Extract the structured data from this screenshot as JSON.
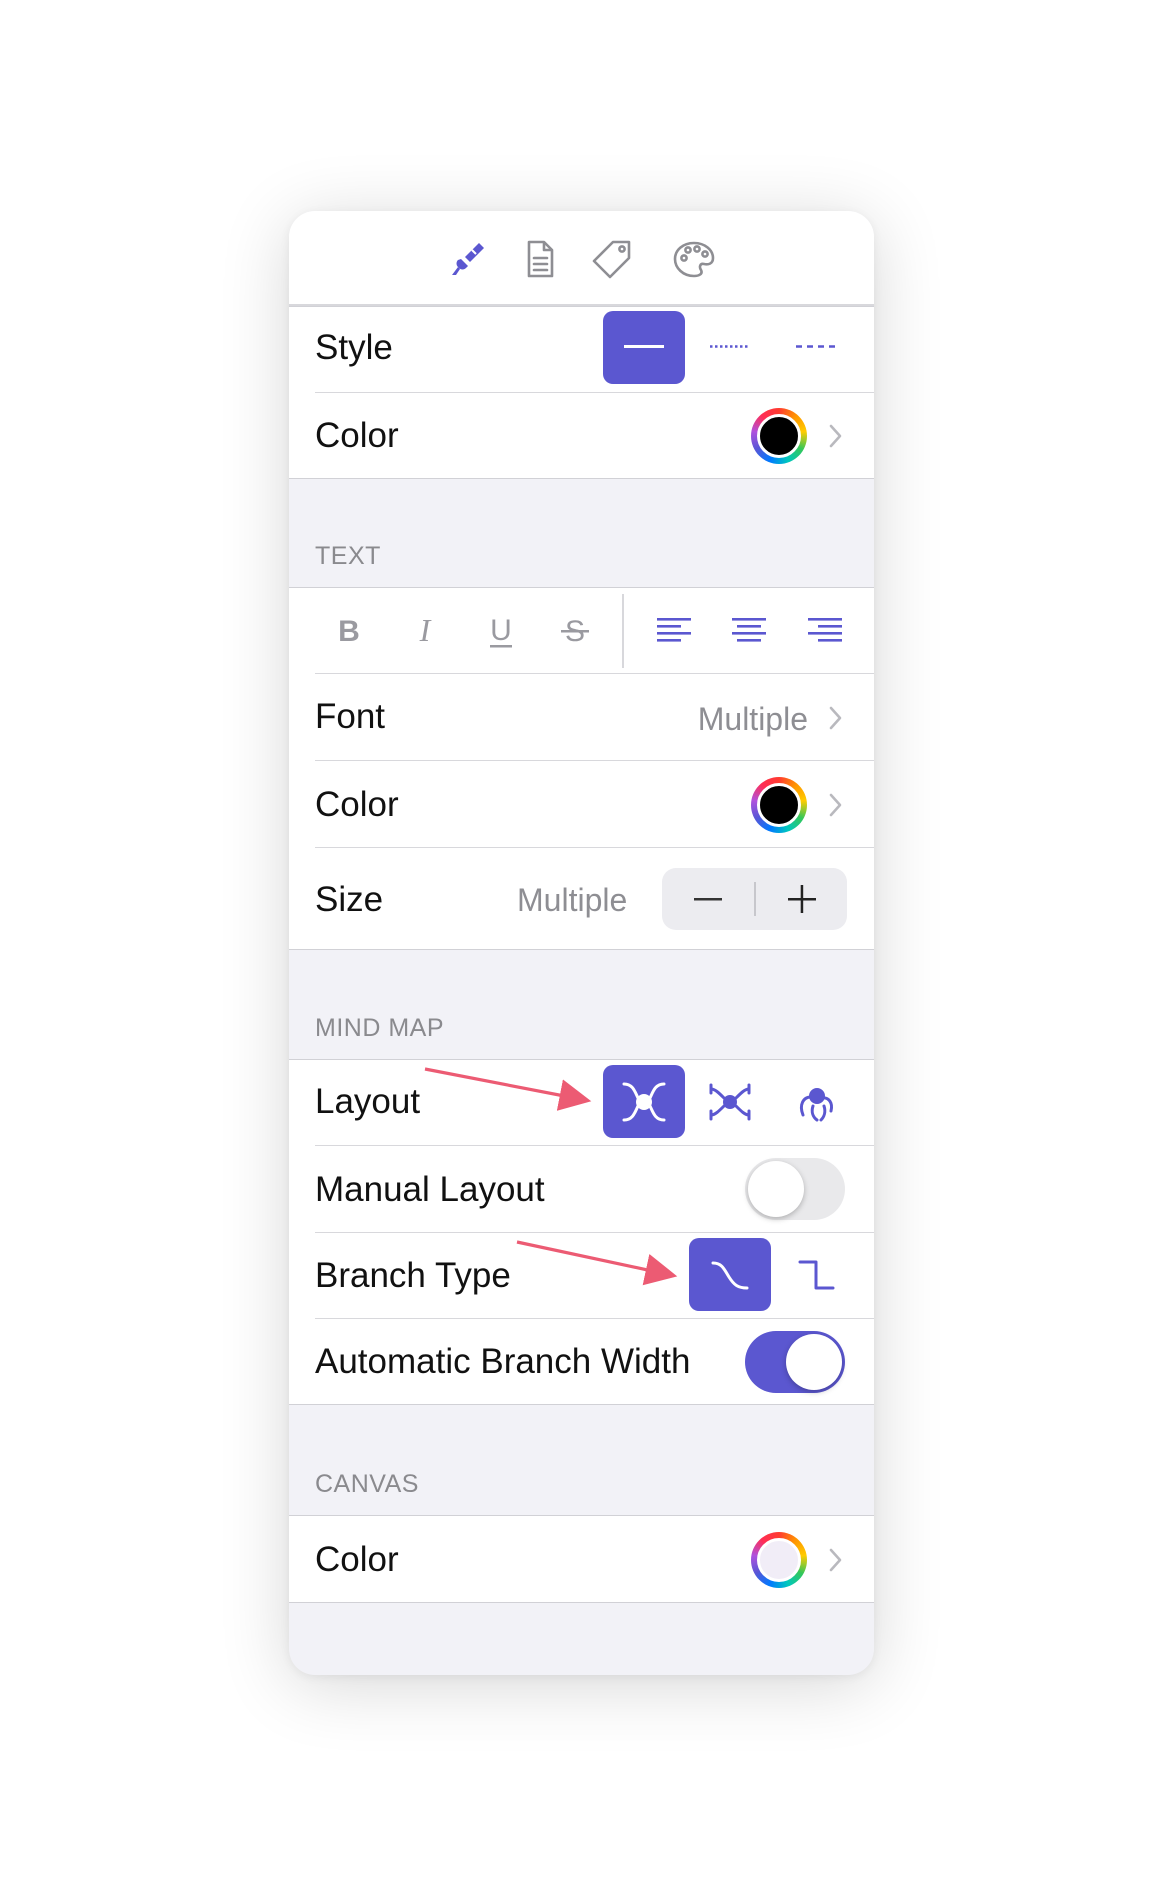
{
  "line": {
    "style_label": "Style",
    "color_label": "Color",
    "color_value": "#000000"
  },
  "text": {
    "header": "TEXT",
    "font_label": "Font",
    "font_value": "Multiple",
    "color_label": "Color",
    "color_value": "#000000",
    "size_label": "Size",
    "size_value": "Multiple"
  },
  "mind_map": {
    "header": "MIND MAP",
    "layout_label": "Layout",
    "manual_layout_label": "Manual Layout",
    "manual_layout_on": false,
    "branch_type_label": "Branch Type",
    "auto_branch_width_label": "Automatic Branch Width",
    "auto_branch_width_on": true
  },
  "canvas": {
    "header": "CANVAS",
    "color_label": "Color",
    "color_value": "#f1edf7"
  },
  "colors": {
    "accent": "#5b57d0",
    "annotation_arrow": "#ec5b73",
    "secondary_text": "#8e8e93"
  },
  "icons": {
    "toolbar": [
      "brush-icon",
      "document-icon",
      "tag-icon",
      "palette-icon"
    ],
    "style_options": [
      "solid-line-icon",
      "dotted-line-icon",
      "dashed-line-icon"
    ],
    "text_format": [
      "bold-icon",
      "italic-icon",
      "underline-icon",
      "strikethrough-icon"
    ],
    "text_align": [
      "align-left-icon",
      "align-center-icon",
      "align-right-icon"
    ],
    "layout_options": [
      "mindmap-layout-icon",
      "balanced-layout-icon",
      "radial-layout-icon"
    ],
    "branch_options": [
      "curved-branch-icon",
      "elbow-branch-icon"
    ]
  }
}
